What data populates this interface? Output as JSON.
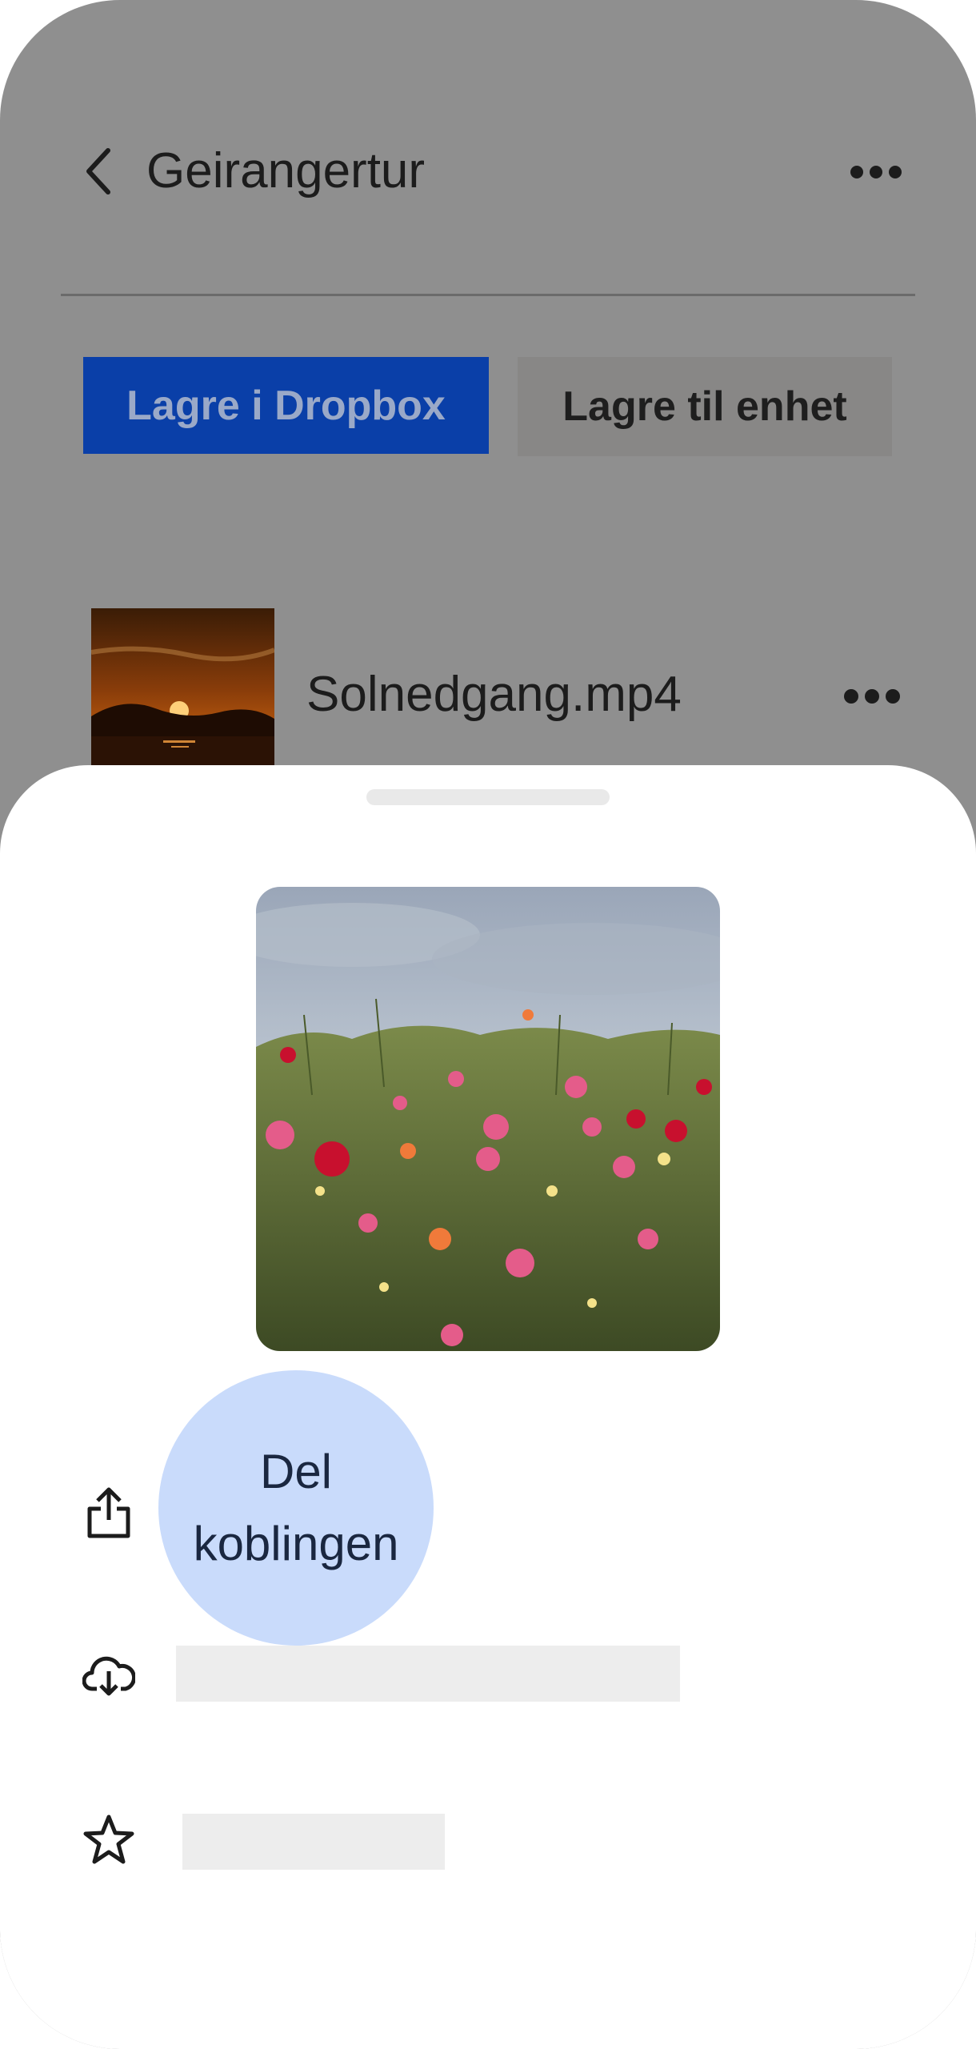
{
  "header": {
    "title": "Geirangertur",
    "back_icon": "chevron-left-icon",
    "more_icon": "more-horizontal-icon"
  },
  "actions": {
    "save_dropbox_label": "Lagre i Dropbox",
    "save_device_label": "Lagre til enhet"
  },
  "files": [
    {
      "name": "Solnedgang.mp4",
      "thumbnail": "sunset-thumbnail",
      "more_icon": "more-horizontal-icon"
    }
  ],
  "sheet": {
    "preview": "flower-field-preview",
    "items": [
      {
        "icon": "share-icon",
        "label_line1": "Del",
        "label_line2": "koblingen"
      },
      {
        "icon": "cloud-download-icon",
        "label": ""
      },
      {
        "icon": "star-icon",
        "label": ""
      }
    ]
  },
  "colors": {
    "overlay_bg": "#8f8f8f",
    "primary_button": "#0a3fa8",
    "highlight_bubble": "#c9dbfb"
  }
}
